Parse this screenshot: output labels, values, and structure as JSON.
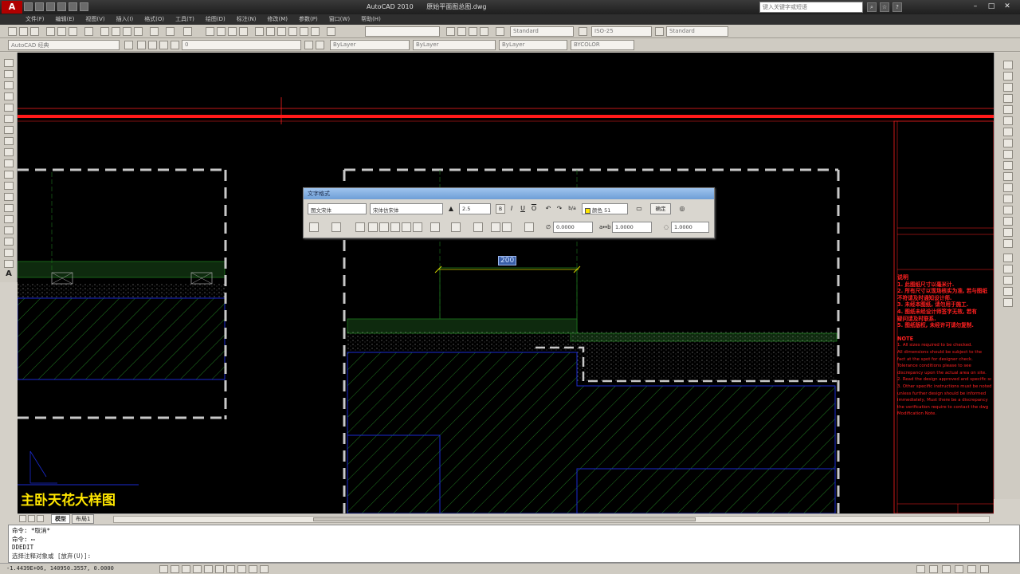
{
  "titlebar": {
    "app": "AutoCAD 2010",
    "file": "原始平面图总图.dwg",
    "search_placeholder": "键入关键字或短语",
    "app_logo_letter": "A"
  },
  "menu": [
    "文件(F)",
    "编辑(E)",
    "视图(V)",
    "插入(I)",
    "格式(O)",
    "工具(T)",
    "绘图(D)",
    "标注(N)",
    "修改(M)",
    "参数(P)",
    "窗口(W)",
    "帮助(H)"
  ],
  "toolbar": {
    "text_style": "Standard",
    "dim_style": "ISO-25",
    "table_style": "Standard",
    "workspace": "AutoCAD 经典",
    "layer_name": "0",
    "color": "ByLayer",
    "linetype": "ByLayer",
    "lineweight": "ByLayer",
    "plotstyle": "BYCOLOR"
  },
  "text_format": {
    "title": "文字格式",
    "style": "图文宋体",
    "font": "宋体仿宋体",
    "height": "2.5",
    "color": "颜色 51",
    "ok_label": "确定",
    "bold": "B",
    "italic": "I",
    "underline": "U",
    "overline": "O",
    "undo": "↶",
    "redo": "↷",
    "stack": "b/a",
    "ruler": "▭",
    "options": "◎",
    "oblique": "0.0000",
    "tracking": "1.0000",
    "width": "1.0000"
  },
  "canvas": {
    "title": "主卧天花大样图",
    "editing_text": "200"
  },
  "notes": {
    "heading": "说明",
    "cn_lines": [
      "1. 此图纸尺寸以毫米计.",
      "2. 所有尺寸以现场核实为准, 若与图纸",
      "  不符请及时通知设计师.",
      "3. 未经本图纸, 请勿用于施工.",
      "4. 图纸未经设计师签字无效, 若有",
      "  疑问请及时联系.",
      "5. 图纸版权, 未经许可请勿复制."
    ],
    "en_heading": "NOTE",
    "en_lines": [
      "1. All sizes required to be checked.",
      "   All dimensions should be subject to the",
      "   fact at the spot for designer check.",
      "   Tolerance conditions please to see",
      "   discrepancy upon the actual area on site.",
      "2. Read the design approved and specific scale.",
      "3. Other specific instructions must be noted,",
      "   unless further design should be informed",
      "   immediately, Must there be a discrepancy",
      "   the verification require to contact the dwg",
      "   Modification Note."
    ]
  },
  "layout_tabs": [
    "模型",
    "布局1"
  ],
  "command": {
    "lines": [
      "命令: *取消*",
      "命令: ▭",
      "DDEDIT"
    ],
    "prompt": "选择注释对象或 [放弃(U)]:"
  },
  "status": {
    "coords": "-1.4439E+06, 140950.3557, 0.0000"
  },
  "colors": {
    "accent_red": "#ff1a1a",
    "title_yellow": "#ffe600",
    "hatch_green": "#1f7a1f",
    "wall_grey": "#c8c8c8",
    "blue_line": "#1a2ad0"
  }
}
